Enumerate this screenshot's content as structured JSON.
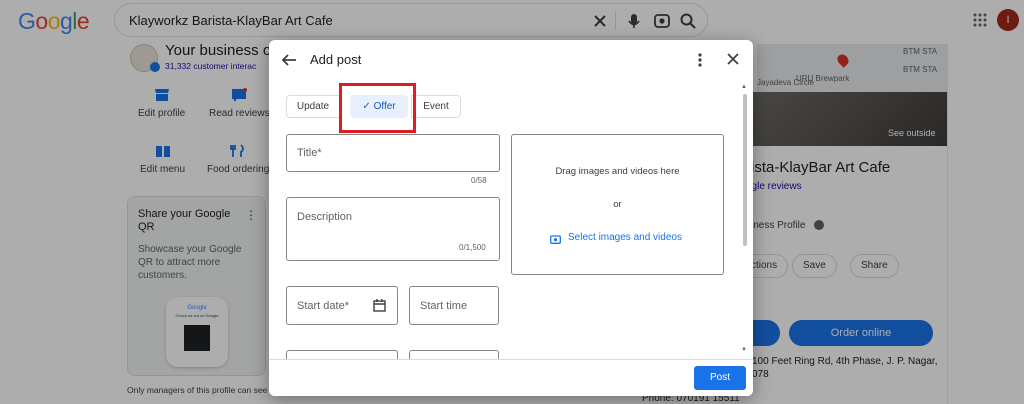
{
  "search": {
    "query": "Klayworkz Barista-KlayBar Art Cafe",
    "logo_letters": [
      "G",
      "o",
      "o",
      "g",
      "l",
      "e"
    ],
    "logo_colors": [
      "#4285F4",
      "#EA4335",
      "#FBBC05",
      "#4285F4",
      "#34A853",
      "#EA4335"
    ],
    "avatar_letter": "I"
  },
  "business_panel": {
    "heading": "Your business on",
    "interactions": "31,332 customer interac",
    "tools": [
      {
        "label": "Edit profile",
        "icon": "storefront-icon"
      },
      {
        "label": "Read reviews",
        "icon": "reviews-icon"
      },
      {
        "label": "Edit menu",
        "icon": "menu-book-icon"
      },
      {
        "label": "Food ordering",
        "icon": "fork-knife-icon"
      }
    ],
    "qr_card": {
      "title": "Share your Google QR",
      "description": "Showcase your Google QR to attract more customers.",
      "badge_brand": "Google",
      "badge_caption": "Check us out on Google"
    },
    "managers_note": "Only managers of this profile can see t"
  },
  "right_panel": {
    "map_labels": [
      "BTM STA",
      "BTM STA",
      "URU Brewpark",
      "Jayadeva Circle"
    ],
    "see_outside": "See outside",
    "title": "rista-KlayBar Art Cafe",
    "reviews_link": "ogle reviews",
    "profile_text": "siness Profile",
    "chips": [
      "ctions",
      "Save",
      "Share"
    ],
    "order_online": "Order online",
    "address": "100 Feet Ring Rd, 4th Phase, J. P. Nagar, 078",
    "phone": "Phone: 070191 15511"
  },
  "dialog": {
    "title": "Add post",
    "tabs": [
      {
        "label": "Update",
        "selected": false
      },
      {
        "label": "Offer",
        "selected": true
      },
      {
        "label": "Event",
        "selected": false
      }
    ],
    "check_mark": "✓",
    "title_field": {
      "placeholder": "Title*",
      "counter": "0/58"
    },
    "description_field": {
      "placeholder": "Description",
      "counter": "0/1,500"
    },
    "start_date": {
      "placeholder": "Start date*"
    },
    "start_time": {
      "placeholder": "Start time"
    },
    "media": {
      "drag_text": "Drag images and videos here",
      "or_text": "or",
      "select_link": "Select images and videos"
    },
    "post_button": "Post"
  },
  "colors": {
    "accent": "#1a73e8",
    "highlight_box": "#e01b24",
    "selected_tab_bg": "#e8f0fe"
  }
}
